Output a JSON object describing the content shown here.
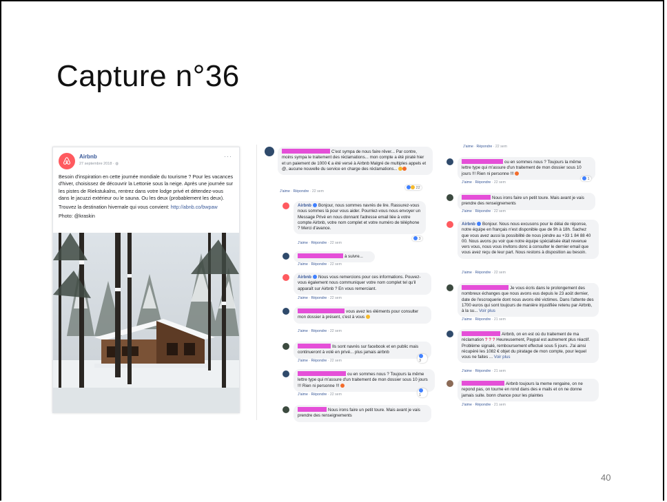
{
  "slide": {
    "title": "Capture n°36",
    "page_number": "40"
  },
  "post": {
    "author": "Airbnb",
    "date": "27 septembre 2018 · ",
    "more": "···",
    "para1": "Besoin d'inspiration en cette journée mondiale du tourisme ? Pour les vacances d'hiver, choisissez de découvrir la Lettonie sous la neige. Après une journée sur les pistes de Riekstukalns, rentrez dans votre lodge privé et détendez-vous dans le jacuzzi extérieur ou le sauna. Ou les deux (probablement les deux).",
    "para2_prefix": "Trouvez la destination hivernale qui vous convient: ",
    "para2_link": "http://abnb.co/bwpaw",
    "para3": "Photo: @kraskin"
  },
  "labels": {
    "like": "J'aime",
    "reply": "Répondre",
    "sep": " · "
  },
  "comments_left": [
    {
      "text": "C'est sympa de nous faire rêver... Par contre, moins sympa le traitement des réclamations... mon compte a été piraté hier et un paiement de 1000 € a été versé à Airbnb Malgré de multiples appels et @, aucune nouvelle du service en charge des réclamations...",
      "time": "22 sem",
      "reactions": "22"
    },
    {
      "name": "Airbnb",
      "text": "Bonjour, nous sommes navrés de lire. Rassurez-vous nous sommes là pour vous aider. Pourriez-vous nous envoyer un Message Privé en nous donnant l'adresse email liée à votre compte Airbnb, votre nom complet et votre numéro de téléphone ? Merci d'avance.",
      "time": "22 sem",
      "reactions": "3"
    },
    {
      "text": "à suivre...",
      "time": "22 sem"
    },
    {
      "name": "Airbnb",
      "text": "Nous vous remercions pour ces informations. Pouvez-vous également nous communiquer votre nom complet tel qu'il apparaît sur Airbnb ? En vous remerciant.",
      "time": "22 sem"
    },
    {
      "text": "vous avez les éléments pour consulter mon dossier à présent, c'est à vous",
      "time": "22 sem"
    },
    {
      "text": "Ils sont navrés sur facebook et en public mais continueront à volé en privé... plus jamais airbnb",
      "time": "22 sem",
      "reactions": "3"
    },
    {
      "text": "ou en sommes nous ? Toujours la même lettre type qui m'assure d'un traitement de mon dossier sous 10 jours !!! Rien ni personne !!!",
      "time": "22 sem",
      "reactions": "1"
    },
    {
      "text": "Nous irons faire un petit toure. Mais avant je vais prendre des renseignements"
    }
  ],
  "comments_right": [
    {
      "time": "22 sem"
    },
    {
      "text": "ou en sommes nous ? Toujours la même lettre type qui m'assure d'un traitement de mon dossier sous 10 jours !!! Rien ni personne !!!",
      "time": "22 sem",
      "reactions": "1"
    },
    {
      "text": "Nous irons faire un petit toure. Mais avant je vais prendre des renseignements",
      "time": "22 sem"
    },
    {
      "name": "Airbnb",
      "text": "Bonjour. Nous nous excusons pour le délai de réponse, notre équipe en français n'est disponible que de 9h à 18h. Sachez que vous avez aussi la possibilité de nous joindre au +33 1 84 88 40 00. Nous avons pu voir que notre équipe spécialisée était revenue vers vous, nous vous invitons donc à consulter le dernier email que vous avez reçu de leur part. Nous restons à disposition au besoin.",
      "time": "22 sem"
    },
    {
      "text": "Je vous écris dans le prolongement des nombreux échanges que nous avons eus depuis le 23 août dernier, date de l'escroquerie dont nous avons été victimes. Dans l'attente des 1700 euros qui sont toujours de manière injustifiée retenu par Airbnb, à la su...",
      "see_more": "Voir plus",
      "time": "21 sem"
    },
    {
      "text_a": "Airbnb, on en est où du traitement de ma réclamation",
      "qmarks": "? ? ?",
      "text_b": "Heureusement, Paypal est autrement plus réactif. Problème signalé, remboursement effectué sous 5 jours. J'ai ainsi récupéré les 1082 € objet du piratage de mon compte, pour lequel vous ne faites ...",
      "see_more": "Voir plus",
      "time": "21 sem"
    },
    {
      "text": "Airbnb toujours la meme rengaine, on ne repond pas, on tourne en rond dans des e mails et on ne donne jamais suite. bonn chance pour les plaintes",
      "time": "21 sem"
    }
  ]
}
